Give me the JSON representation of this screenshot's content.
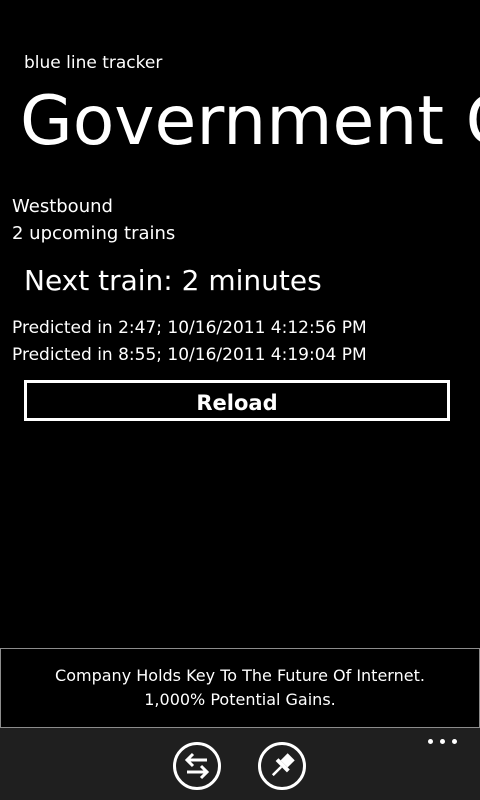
{
  "app": {
    "title": "blue line tracker"
  },
  "page": {
    "title": "Government Center"
  },
  "station": {
    "direction": "Westbound",
    "upcoming_count": "2 upcoming trains",
    "next_train": "Next train: 2 minutes",
    "predictions": [
      "Predicted in 2:47; 10/16/2011 4:12:56 PM",
      "Predicted in 8:55; 10/16/2011 4:19:04 PM"
    ]
  },
  "actions": {
    "reload_label": "Reload"
  },
  "ad": {
    "line1": "Company Holds Key To The Future Of Internet.",
    "line2": "1,000% Potential Gains."
  },
  "app_bar": {
    "buttons": [
      {
        "icon": "switch-direction-icon"
      },
      {
        "icon": "pin-icon"
      }
    ],
    "more_icon": "more-options-icon"
  }
}
